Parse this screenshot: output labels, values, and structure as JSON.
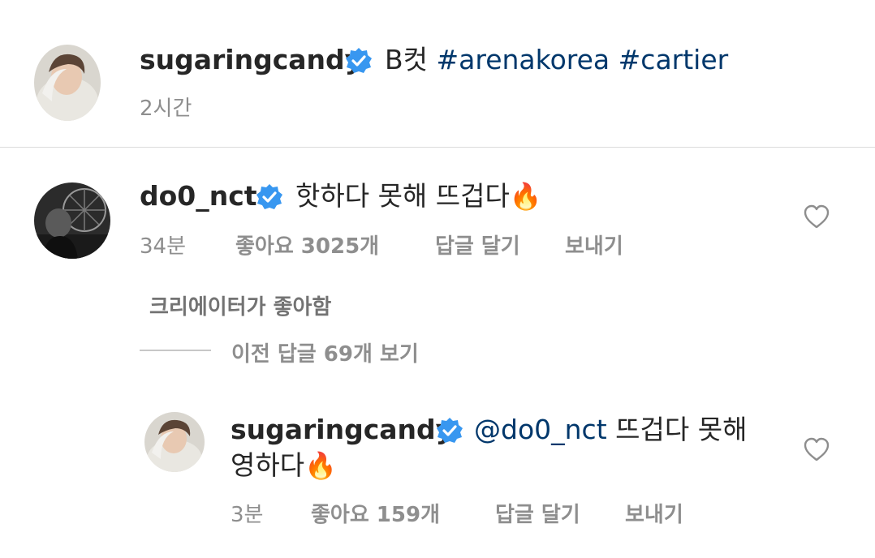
{
  "caption": {
    "username": "sugaringcandy",
    "text": "B컷",
    "hashtags": [
      "#arenakorea",
      "#cartier"
    ],
    "time": "2시간"
  },
  "comment": {
    "username": "do0_nct",
    "text": "핫하다 못해 뜨겁다",
    "emoji": "🔥",
    "time": "34분",
    "likes": "좋아요 3025개",
    "reply_label": "답글 달기",
    "send_label": "보내기",
    "creator_liked": "크리에이터가 좋아함",
    "view_replies": "이전 답글 69개 보기"
  },
  "reply": {
    "username": "sugaringcandy",
    "mention": "@do0_nct",
    "text_line1": "뜨겁다 못해",
    "text_line2": "영하다",
    "emoji": "🔥",
    "time": "3분",
    "likes": "좋아요 159개",
    "reply_label": "답글 달기",
    "send_label": "보내기"
  },
  "colors": {
    "verified": "#3897f0",
    "link": "#00376b",
    "meta": "#8e8e8e",
    "divider": "#dbdbdb"
  }
}
